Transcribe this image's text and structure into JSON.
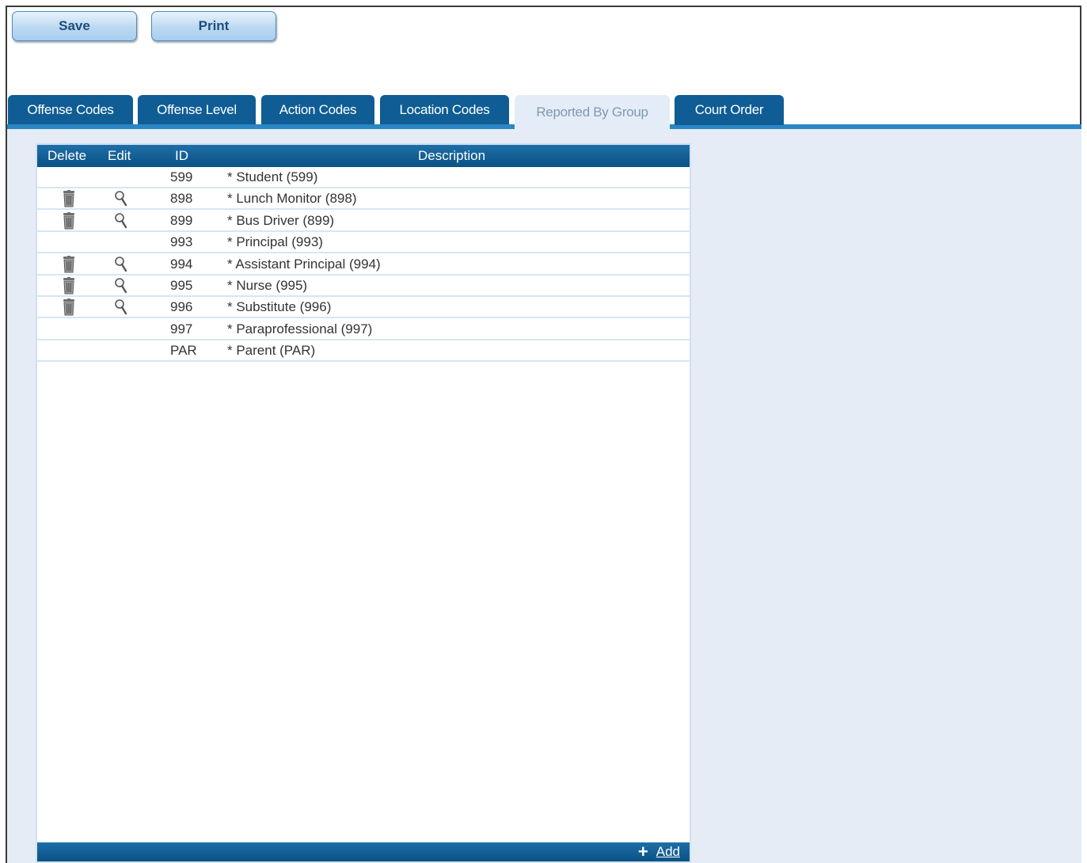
{
  "toolbar": {
    "save_label": "Save",
    "print_label": "Print"
  },
  "tabs": [
    {
      "label": "Offense Codes",
      "active": false
    },
    {
      "label": "Offense Level",
      "active": false
    },
    {
      "label": "Action Codes",
      "active": false
    },
    {
      "label": "Location Codes",
      "active": false
    },
    {
      "label": "Reported By Group",
      "active": true
    },
    {
      "label": "Court Order",
      "active": false
    }
  ],
  "grid": {
    "columns": {
      "delete": "Delete",
      "edit": "Edit",
      "id": "ID",
      "description": "Description"
    },
    "rows": [
      {
        "id": "599",
        "description": "* Student (599)",
        "editable": false
      },
      {
        "id": "898",
        "description": "* Lunch Monitor (898)",
        "editable": true
      },
      {
        "id": "899",
        "description": "* Bus Driver (899)",
        "editable": true
      },
      {
        "id": "993",
        "description": "* Principal (993)",
        "editable": false
      },
      {
        "id": "994",
        "description": "* Assistant Principal (994)",
        "editable": true
      },
      {
        "id": "995",
        "description": "* Nurse (995)",
        "editable": true
      },
      {
        "id": "996",
        "description": "* Substitute (996)",
        "editable": true
      },
      {
        "id": "997",
        "description": "* Paraprofessional (997)",
        "editable": false
      },
      {
        "id": "PAR",
        "description": "* Parent (PAR)",
        "editable": false
      }
    ],
    "add_label": "Add",
    "icons": {
      "delete": "trash-icon",
      "edit": "magnifier-icon",
      "add": "plus-icon"
    }
  },
  "colors": {
    "tab_bg": "#0f5d94",
    "tab_active_bg": "#e4edf7",
    "accent": "#2a86c4",
    "panel_bg": "#e5ecf6"
  }
}
